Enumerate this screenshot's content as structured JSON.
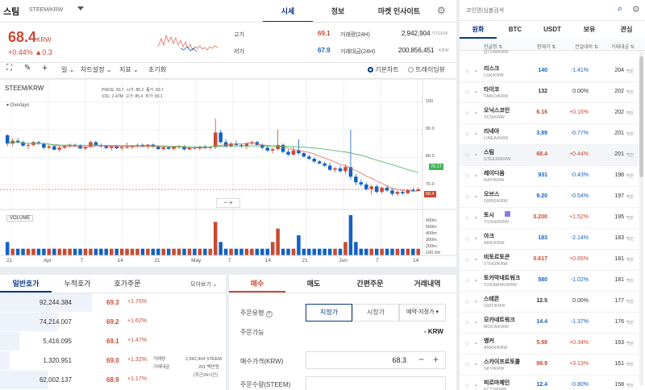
{
  "header": {
    "coin_name": "스팀",
    "pair": "STEEM/KRW",
    "tabs": [
      {
        "label": "시세",
        "active": true
      },
      {
        "label": "정보",
        "active": false
      },
      {
        "label": "마켓 인사이트",
        "active": false
      }
    ],
    "settings_icon": "gear-icon"
  },
  "ticker": {
    "price": "68.4",
    "currency": "KRW",
    "change_pct": "+0.44%",
    "change_abs": "▲0.3",
    "high_label": "고가",
    "high": "69.1",
    "low_label": "저가",
    "low": "67.9",
    "volume_label": "거래량(24H)",
    "volume": "2,942,904",
    "volume_unit": "STEEM",
    "value_label": "거래대금(24H)",
    "value": "200,856,451",
    "value_unit": "KRW"
  },
  "toolbar": {
    "period": "일",
    "chart_settings": "차트설정",
    "indicators": "지표",
    "reset": "초기화",
    "basic_chart": "기본차트",
    "trading_view": "트레이딩뷰"
  },
  "chart_data": {
    "type": "candlestick",
    "title": "STEEM/KRW",
    "ohlc_legend": {
      "price_label": "PRICE:",
      "price": "83.7",
      "open_label": "시가:",
      "open": "85.2",
      "close_label": "종가:",
      "close": "83.7",
      "vol_label": "VOL:",
      "vol": "2.47M",
      "high_label": "고가:",
      "high": "85.4",
      "low_label": "저가:",
      "low": "83.1"
    },
    "overlays_label": "Overlays",
    "volume_label": "VOLUME",
    "x_ticks": [
      "21",
      "Apr",
      "7",
      "14",
      "21",
      "May",
      "7",
      "14",
      "21",
      "Jun",
      "7",
      "14"
    ],
    "y_ticks": [
      "100",
      "90.0",
      "80.0",
      "70.0"
    ],
    "vol_ticks": [
      "600m",
      "500m",
      "400m",
      "300m",
      "200m",
      "100.0m"
    ],
    "current_price_tag": "68.4",
    "ma_tag": "76.17",
    "ylim": [
      62,
      104
    ],
    "candles": [
      [
        88,
        88.5,
        84,
        85
      ],
      [
        85,
        87,
        84,
        86
      ],
      [
        86,
        87,
        85,
        85.5
      ],
      [
        85.5,
        86,
        84,
        84.2
      ],
      [
        84.2,
        85,
        83,
        84.5
      ],
      [
        84.5,
        86,
        84,
        85.5
      ],
      [
        85.5,
        86,
        84.5,
        85
      ],
      [
        85,
        85.5,
        83,
        83.5
      ],
      [
        83.5,
        84.5,
        83,
        84
      ],
      [
        84,
        84.2,
        82.5,
        82.8
      ],
      [
        82.8,
        84,
        82,
        83.5
      ],
      [
        83.5,
        84.5,
        83,
        84
      ],
      [
        84,
        85,
        83.5,
        84.5
      ],
      [
        84.5,
        85,
        84,
        84.2
      ],
      [
        84.2,
        84.8,
        83,
        83.2
      ],
      [
        83.2,
        84,
        82.5,
        83.8
      ],
      [
        83.8,
        86,
        83.5,
        85.5
      ],
      [
        85.5,
        86,
        84,
        84.4
      ],
      [
        84.4,
        85,
        83.5,
        84
      ],
      [
        84,
        84.5,
        83,
        83.4
      ],
      [
        83.4,
        84,
        82.5,
        83.9
      ],
      [
        83.9,
        84.5,
        83,
        83.3
      ],
      [
        83.3,
        84,
        82.5,
        83.7
      ],
      [
        83.7,
        85.4,
        83.1,
        83.7
      ],
      [
        83.7,
        84.5,
        83,
        84.2
      ],
      [
        84.2,
        85,
        83.5,
        84.5
      ],
      [
        84.5,
        85,
        83.8,
        84
      ],
      [
        84,
        84.8,
        83,
        84.6
      ],
      [
        84.6,
        85,
        83.5,
        83.8
      ],
      [
        83.8,
        84.2,
        82.8,
        83
      ],
      [
        83,
        84,
        82.5,
        83.6
      ],
      [
        83.6,
        84,
        82.8,
        83.1
      ],
      [
        83.1,
        84,
        82.5,
        83.8
      ],
      [
        83.8,
        84.5,
        83,
        84
      ],
      [
        84,
        84.5,
        82.5,
        82.9
      ],
      [
        82.9,
        84,
        82.5,
        83.5
      ],
      [
        83.5,
        84,
        82.8,
        83.2
      ],
      [
        83.2,
        84.2,
        82.5,
        83.9
      ],
      [
        83.9,
        84.5,
        83,
        83.4
      ],
      [
        83.4,
        84,
        82.8,
        83.7
      ],
      [
        83.7,
        94,
        83,
        89
      ],
      [
        89,
        90,
        85,
        85.5
      ],
      [
        85.5,
        86.5,
        83.5,
        84
      ],
      [
        84,
        85.5,
        83.5,
        85
      ],
      [
        85,
        86,
        84,
        84.5
      ],
      [
        84.5,
        85,
        83.5,
        84.2
      ],
      [
        84.2,
        85,
        83,
        85
      ],
      [
        85,
        86,
        84.5,
        85.5
      ],
      [
        85.5,
        86,
        84,
        84.5
      ],
      [
        84.5,
        85,
        83,
        83.5
      ],
      [
        83.5,
        84,
        82,
        82.5
      ],
      [
        82.5,
        83.5,
        81.5,
        83
      ],
      [
        83,
        90,
        82.5,
        84.5
      ],
      [
        84.5,
        85,
        81.5,
        82
      ],
      [
        82,
        83,
        80.5,
        81
      ],
      [
        81,
        84,
        80.5,
        82.5
      ],
      [
        82.5,
        86.5,
        81,
        81.5
      ],
      [
        81.5,
        82,
        80,
        80.3
      ],
      [
        80.3,
        81,
        79,
        79.5
      ],
      [
        79.5,
        80,
        78,
        78.5
      ],
      [
        78.5,
        79,
        77.5,
        77.8
      ],
      [
        77.8,
        78.5,
        76.5,
        77
      ],
      [
        77,
        78,
        75,
        75.5
      ],
      [
        75.5,
        76.5,
        74.5,
        76
      ],
      [
        76,
        77,
        74.5,
        75
      ],
      [
        75,
        77.5,
        74,
        76.5
      ],
      [
        76.5,
        90,
        72,
        73
      ],
      [
        73,
        74,
        70,
        71
      ],
      [
        71,
        72,
        69.5,
        70.2
      ],
      [
        70.2,
        71,
        68,
        68.5
      ],
      [
        68.5,
        70,
        66.5,
        69.5
      ],
      [
        69.5,
        70,
        67,
        67.5
      ],
      [
        67.5,
        69.5,
        66.8,
        69
      ],
      [
        69,
        70,
        67.5,
        68
      ],
      [
        68,
        69,
        66,
        66.8
      ],
      [
        66.8,
        68,
        66,
        67.5
      ],
      [
        67.5,
        68.5,
        66.5,
        67
      ],
      [
        67,
        68.5,
        66.8,
        68.2
      ],
      [
        68.2,
        69,
        67.5,
        67.8
      ],
      [
        67.8,
        69.1,
        67.9,
        68.4
      ]
    ],
    "volume": [
      2,
      1,
      1,
      1,
      1,
      1,
      1,
      1,
      1,
      1,
      1,
      1,
      1,
      1,
      1,
      1,
      1,
      1,
      1,
      1,
      1,
      1,
      1,
      1,
      1,
      1,
      1,
      1,
      1,
      1,
      1,
      1,
      1,
      1,
      1,
      1,
      1,
      1,
      1,
      1,
      5,
      2,
      1,
      1,
      1,
      1,
      1,
      1,
      1,
      1,
      1,
      2,
      4,
      1,
      1,
      1,
      3,
      1,
      1,
      1,
      1,
      1,
      1,
      1,
      1,
      2,
      6,
      2,
      1,
      1,
      1,
      1,
      1,
      1,
      1,
      1,
      1,
      1,
      1,
      1
    ]
  },
  "orderbook": {
    "tabs": [
      {
        "label": "일반호가",
        "active": true
      },
      {
        "label": "누적호가",
        "active": false
      },
      {
        "label": "호가주문",
        "active": false
      }
    ],
    "view_mode": "모아보기",
    "rows": [
      {
        "qty": "92,244.384",
        "price": "69.3",
        "pct": "+1.76%",
        "fill": 0.95
      },
      {
        "qty": "74,214.007",
        "price": "69.2",
        "pct": "+1.62%",
        "fill": 0.6
      },
      {
        "qty": "5,416.095",
        "price": "69.1",
        "pct": "+1.47%",
        "fill": 0.2
      },
      {
        "qty": "1,320.951",
        "price": "69.0",
        "pct": "+1.32%",
        "fill": 0.1
      },
      {
        "qty": "62,002.137",
        "price": "68.9",
        "pct": "+1.17%",
        "fill": 0.5
      }
    ],
    "info": {
      "volume_label": "거래량",
      "volume": "2,942,904",
      "volume_unit": "STEEM",
      "value_label": "거래대금",
      "value": "201",
      "value_unit": "백만원",
      "period": "(최근24시간)"
    }
  },
  "order_form": {
    "tabs": [
      {
        "label": "매수",
        "active": true
      },
      {
        "label": "매도",
        "active": false
      },
      {
        "label": "간편주문",
        "active": false
      },
      {
        "label": "거래내역",
        "active": false
      }
    ],
    "order_type_label": "주문유형",
    "order_types": [
      "지정가",
      "시장가",
      "예약-지정가"
    ],
    "available_label": "주문가능",
    "available_value": "- KRW",
    "price_label": "매수가격(KRW)",
    "price_value": "68.3",
    "qty_label": "주문수량(STEEM)"
  },
  "coin_list": {
    "search_placeholder": "코인명/심볼검색",
    "tabs": [
      {
        "label": "원화",
        "active": true
      },
      {
        "label": "BTC",
        "active": false
      },
      {
        "label": "USDT",
        "active": false
      },
      {
        "label": "보유",
        "active": false
      },
      {
        "label": "관심",
        "active": false
      }
    ],
    "columns": {
      "name": "한글명",
      "price": "현재가",
      "change": "전일대비",
      "volume": "거래대금"
    },
    "partial_top": "QTUM/KRW",
    "coins": [
      {
        "name": "리스크",
        "symbol": "LSK/KRW",
        "price": "140",
        "change": "-1.41%",
        "vol": "204",
        "dir": "down"
      },
      {
        "name": "타이코",
        "symbol": "TAIKO/KRW",
        "price": "132",
        "change": "0.00%",
        "vol": "202",
        "dir": "flat"
      },
      {
        "name": "오닉스코인",
        "symbol": "XCN/KRW",
        "price": "6.16",
        "change": "+0.16%",
        "vol": "202",
        "dir": "up"
      },
      {
        "name": "리네아",
        "symbol": "LINEA/KRW",
        "price": "3.89",
        "change": "-0.77%",
        "vol": "201",
        "dir": "down"
      },
      {
        "name": "스팀",
        "symbol": "STEEM/KRW",
        "price": "68.4",
        "change": "+0.44%",
        "vol": "201",
        "dir": "up",
        "selected": true
      },
      {
        "name": "레이디움",
        "symbol": "RAY/KRW",
        "price": "931",
        "change": "-0.43%",
        "vol": "198",
        "dir": "down"
      },
      {
        "name": "오브스",
        "symbol": "ORBS/KRW",
        "price": "9.20",
        "change": "-0.54%",
        "vol": "197",
        "dir": "down"
      },
      {
        "name": "토시",
        "symbol": "TOSHI/KRW",
        "price": "0.200",
        "change": "+1.52%",
        "vol": "195",
        "dir": "up",
        "badge": true
      },
      {
        "name": "아크",
        "symbol": "ARK/KRW",
        "price": "183",
        "change": "-2.14%",
        "vol": "183",
        "dir": "down"
      },
      {
        "name": "비토르토큰",
        "symbol": "VTHO/KRW",
        "price": "0.617",
        "change": "+0.65%",
        "vol": "181",
        "dir": "up"
      },
      {
        "name": "토카막네트워크",
        "symbol": "TOKAMAK/KRW",
        "price": "580",
        "change": "-1.02%",
        "vol": "181",
        "dir": "down"
      },
      {
        "name": "스테픈",
        "symbol": "GMT/KRW",
        "price": "12.5",
        "change": "0.00%",
        "vol": "177",
        "dir": "flat"
      },
      {
        "name": "모카네트워크",
        "symbol": "MOCA/KRW",
        "price": "14.4",
        "change": "-1.37%",
        "vol": "176",
        "dir": "down"
      },
      {
        "name": "앵커",
        "symbol": "ANKR/KRW",
        "price": "5.98",
        "change": "+0.34%",
        "vol": "163",
        "dir": "up"
      },
      {
        "name": "스카이프로토콜",
        "symbol": "SKY/KRW",
        "price": "88.9",
        "change": "+3.13%",
        "vol": "161",
        "dir": "up"
      },
      {
        "name": "피르마체인",
        "symbol": "FCT2/KRW",
        "price": "12.4",
        "change": "-0.80%",
        "vol": "158",
        "dir": "down"
      }
    ],
    "vol_unit": "백만"
  },
  "colors": {
    "up": "#c84a31",
    "down": "#1261c4",
    "accent": "#093687",
    "ma_green": "#44b35a",
    "ma_red": "#e06a5a"
  }
}
